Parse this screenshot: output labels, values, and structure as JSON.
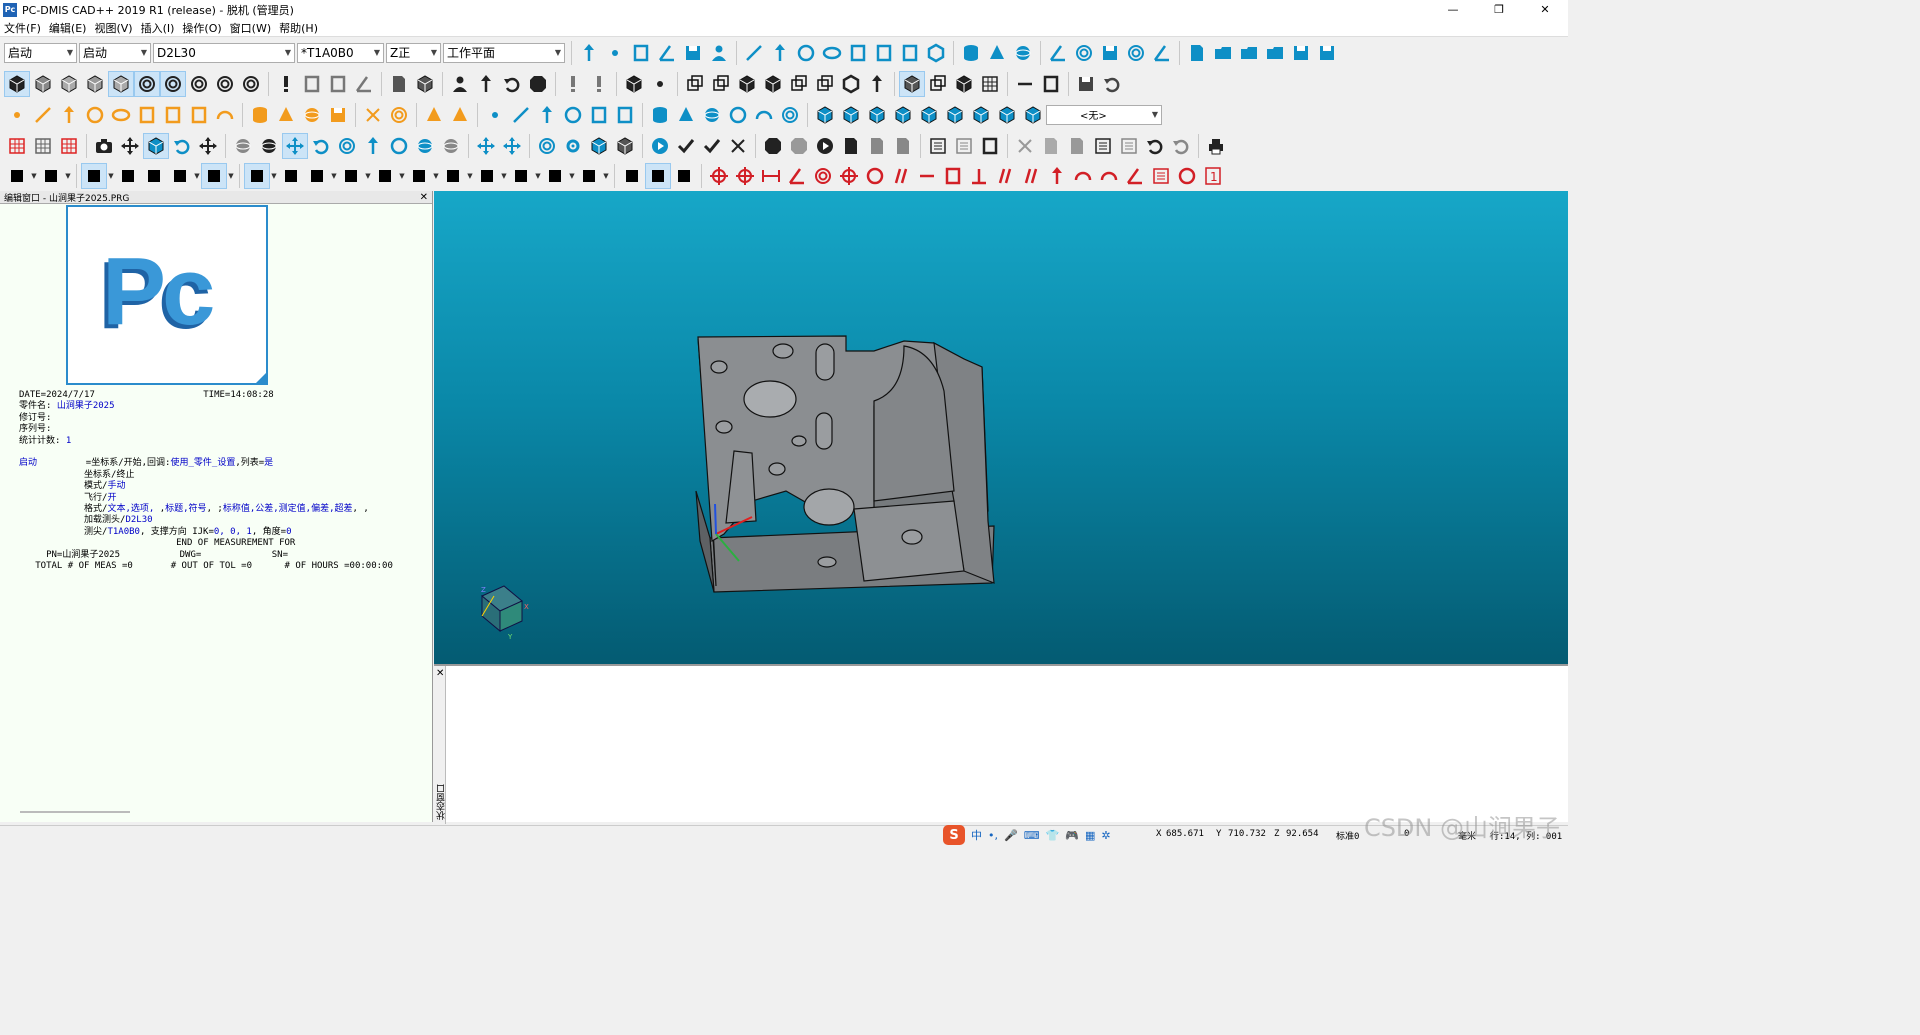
{
  "titlebar": {
    "logo": "Pc",
    "title": "PC-DMIS CAD++ 2019 R1 (release) - 脱机 (管理员)",
    "min": "—",
    "max": "❐",
    "close": "✕"
  },
  "menu": [
    "文件(F)",
    "编辑(E)",
    "视图(V)",
    "插入(I)",
    "操作(O)",
    "窗口(W)",
    "帮助(H)"
  ],
  "combos": {
    "alignment": "启动",
    "alignment2": "启动",
    "probe": "D2L30",
    "tip": "*T1A0B0",
    "view": "Z正",
    "workplane": "工作平面",
    "none_option": "<无>"
  },
  "editor": {
    "title": "编辑窗口 - 山涧果子2025.PRG",
    "close": "✕",
    "logo_text": "Pc",
    "date_line": "DATE=2024/7/17                    TIME=14:08:28",
    "part_label": "零件名:",
    "part_value": "山涧果子2025",
    "rev_label": "修订号:",
    "serial_label": "序列号:",
    "stat_label": "统计计数:",
    "stat_value": "1",
    "start_kw": "启动",
    "start_line_a": "=坐标系/开始,回调:",
    "start_line_b": "使用_零件_设置",
    "start_line_c": ",列表=",
    "start_line_d": "是",
    "line_coord_end": "坐标系/终止",
    "line_mode_a": "模式/",
    "line_mode_b": "手动",
    "line_fly_a": "飞行/",
    "line_fly_b": "开",
    "line_format_a": "格式/",
    "line_format_b": "文本,选项,",
    "line_format_c": " ,",
    "line_format_d": "标题,符号",
    "line_format_e": ", ;",
    "line_format_f": "标称值,公差,测定值,偏差,超差",
    "line_format_g": ", ,",
    "line_load_a": "加载测头/",
    "line_load_b": "D2L30",
    "line_tip_a": "测尖/",
    "line_tip_b": "T1A0B0",
    "line_tip_c": ", 支撑方向 IJK=",
    "line_tip_d": "0, 0, 1",
    "line_tip_e": ", 角度=",
    "line_tip_f": "0",
    "end_line": "                             END OF MEASUREMENT FOR",
    "pn_line": "     PN=山涧果子2025           DWG=             SN=",
    "total_line": "   TOTAL # OF MEAS =0       # OUT OF TOL =0      # OF HOURS =00:00:00"
  },
  "status_window": {
    "label": "状态窗口",
    "close": "✕"
  },
  "axes": {
    "x": "X",
    "y": "Y",
    "z": "Z"
  },
  "statusbar": {
    "x_label": "X",
    "x_value": "685.671",
    "y_label": "Y",
    "y_value": "710.732",
    "z_label": "Z",
    "z_value": "92.654",
    "std_label": "标准0",
    "zero": "0",
    "unit": "毫米",
    "row_col": "行:14, 列: 001",
    "ime": [
      "中",
      "•,",
      "🎤",
      "⌨",
      "👕",
      "🎮",
      "▦",
      "✲"
    ]
  },
  "watermark": "CSDN @山涧果子",
  "colors": {
    "toolbar_blue": "#0e8fc6",
    "toolbar_red": "#d21f26",
    "viewport_top": "#17a7c8",
    "viewport_bottom": "#045b72",
    "keyword_blue": "#0000c8"
  }
}
